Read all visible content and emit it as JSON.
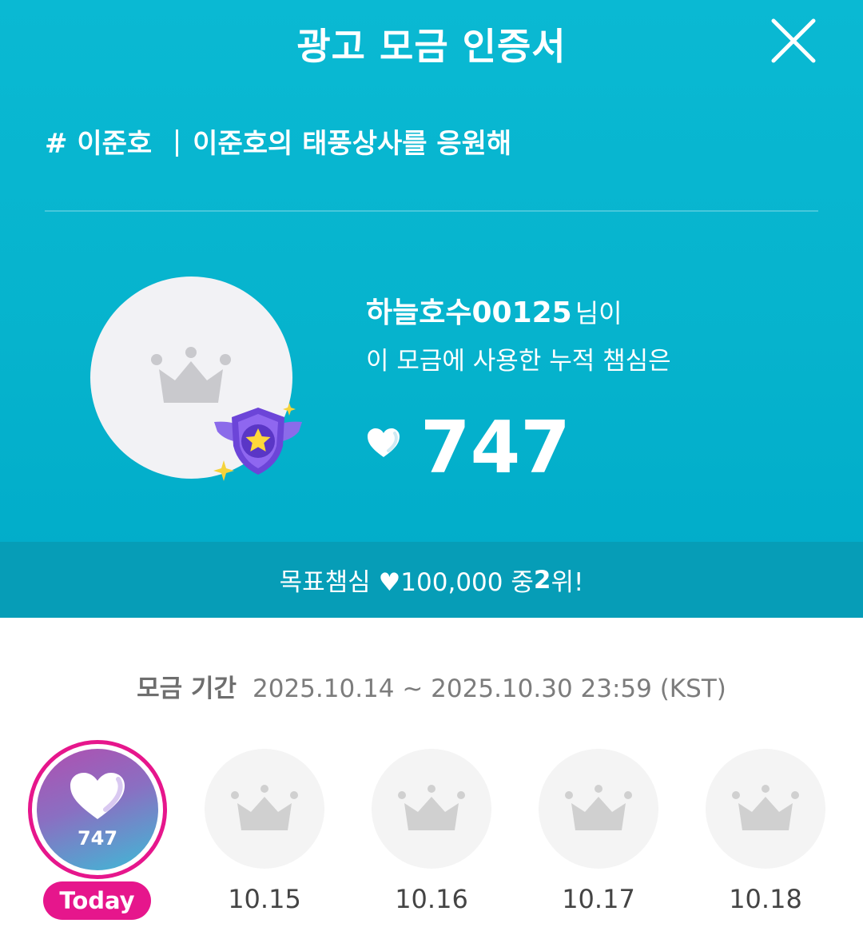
{
  "header": {
    "title": "광고 모금 인증서",
    "close_icon": "close-icon"
  },
  "campaign": {
    "hashtag": "# 이준호",
    "name": "이준호의 태풍상사를 응원해"
  },
  "donor": {
    "username": "하늘호수00125",
    "username_suffix": "님이",
    "description": "이 모금에 사용한 누적 챔심은",
    "total_hearts": "747",
    "avatar_icon": "crown-icon",
    "badge_icon": "star-shield-badge-icon"
  },
  "rank": {
    "prefix": "목표챔심 ♥100,000 중 ",
    "position": "2",
    "suffix": "위!"
  },
  "period": {
    "label": "모금 기간",
    "range": "2025.10.14 ~ 2025.10.30 23:59 (KST)"
  },
  "days": [
    {
      "label": "Today",
      "value": "747",
      "icon": "heart-icon",
      "active": true
    },
    {
      "label": "10.15",
      "icon": "crown-icon",
      "active": false
    },
    {
      "label": "10.16",
      "icon": "crown-icon",
      "active": false
    },
    {
      "label": "10.17",
      "icon": "crown-icon",
      "active": false
    },
    {
      "label": "10.18",
      "icon": "crown-icon",
      "active": false
    }
  ],
  "colors": {
    "header_bg": "#06b3cd",
    "rank_bar_bg": "#069db7",
    "today_accent": "#e6168c"
  }
}
